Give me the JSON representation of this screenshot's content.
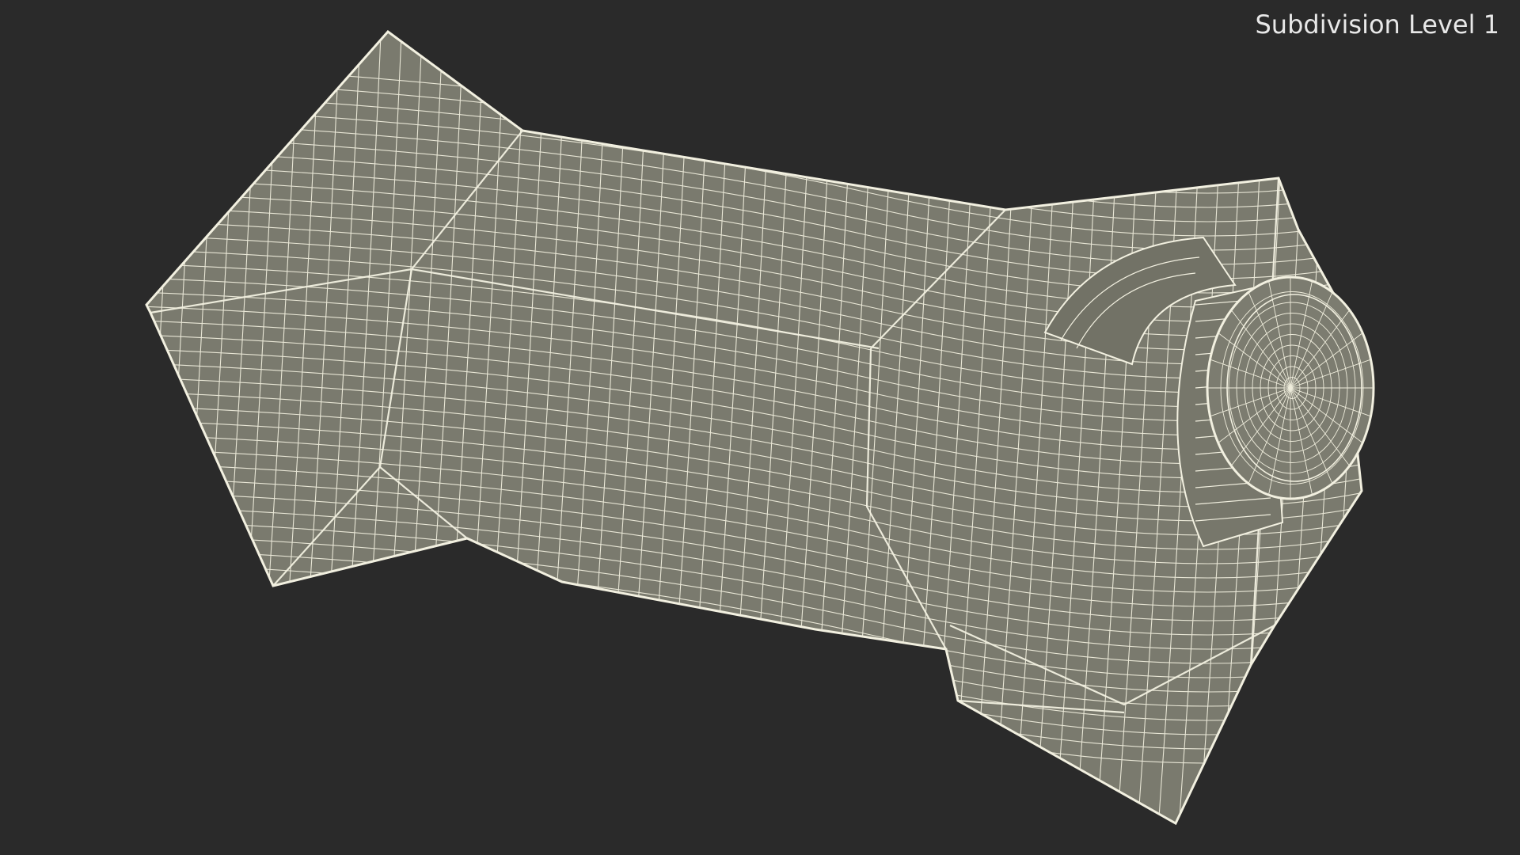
{
  "viewport": {
    "label": "Subdivision Level 1",
    "background_color": "#2a2a2a",
    "mesh_fill_color": "#7a7a6e",
    "wire_color": "#f2f0e0"
  },
  "subject": {
    "icon": "carton-wireframe-model"
  }
}
